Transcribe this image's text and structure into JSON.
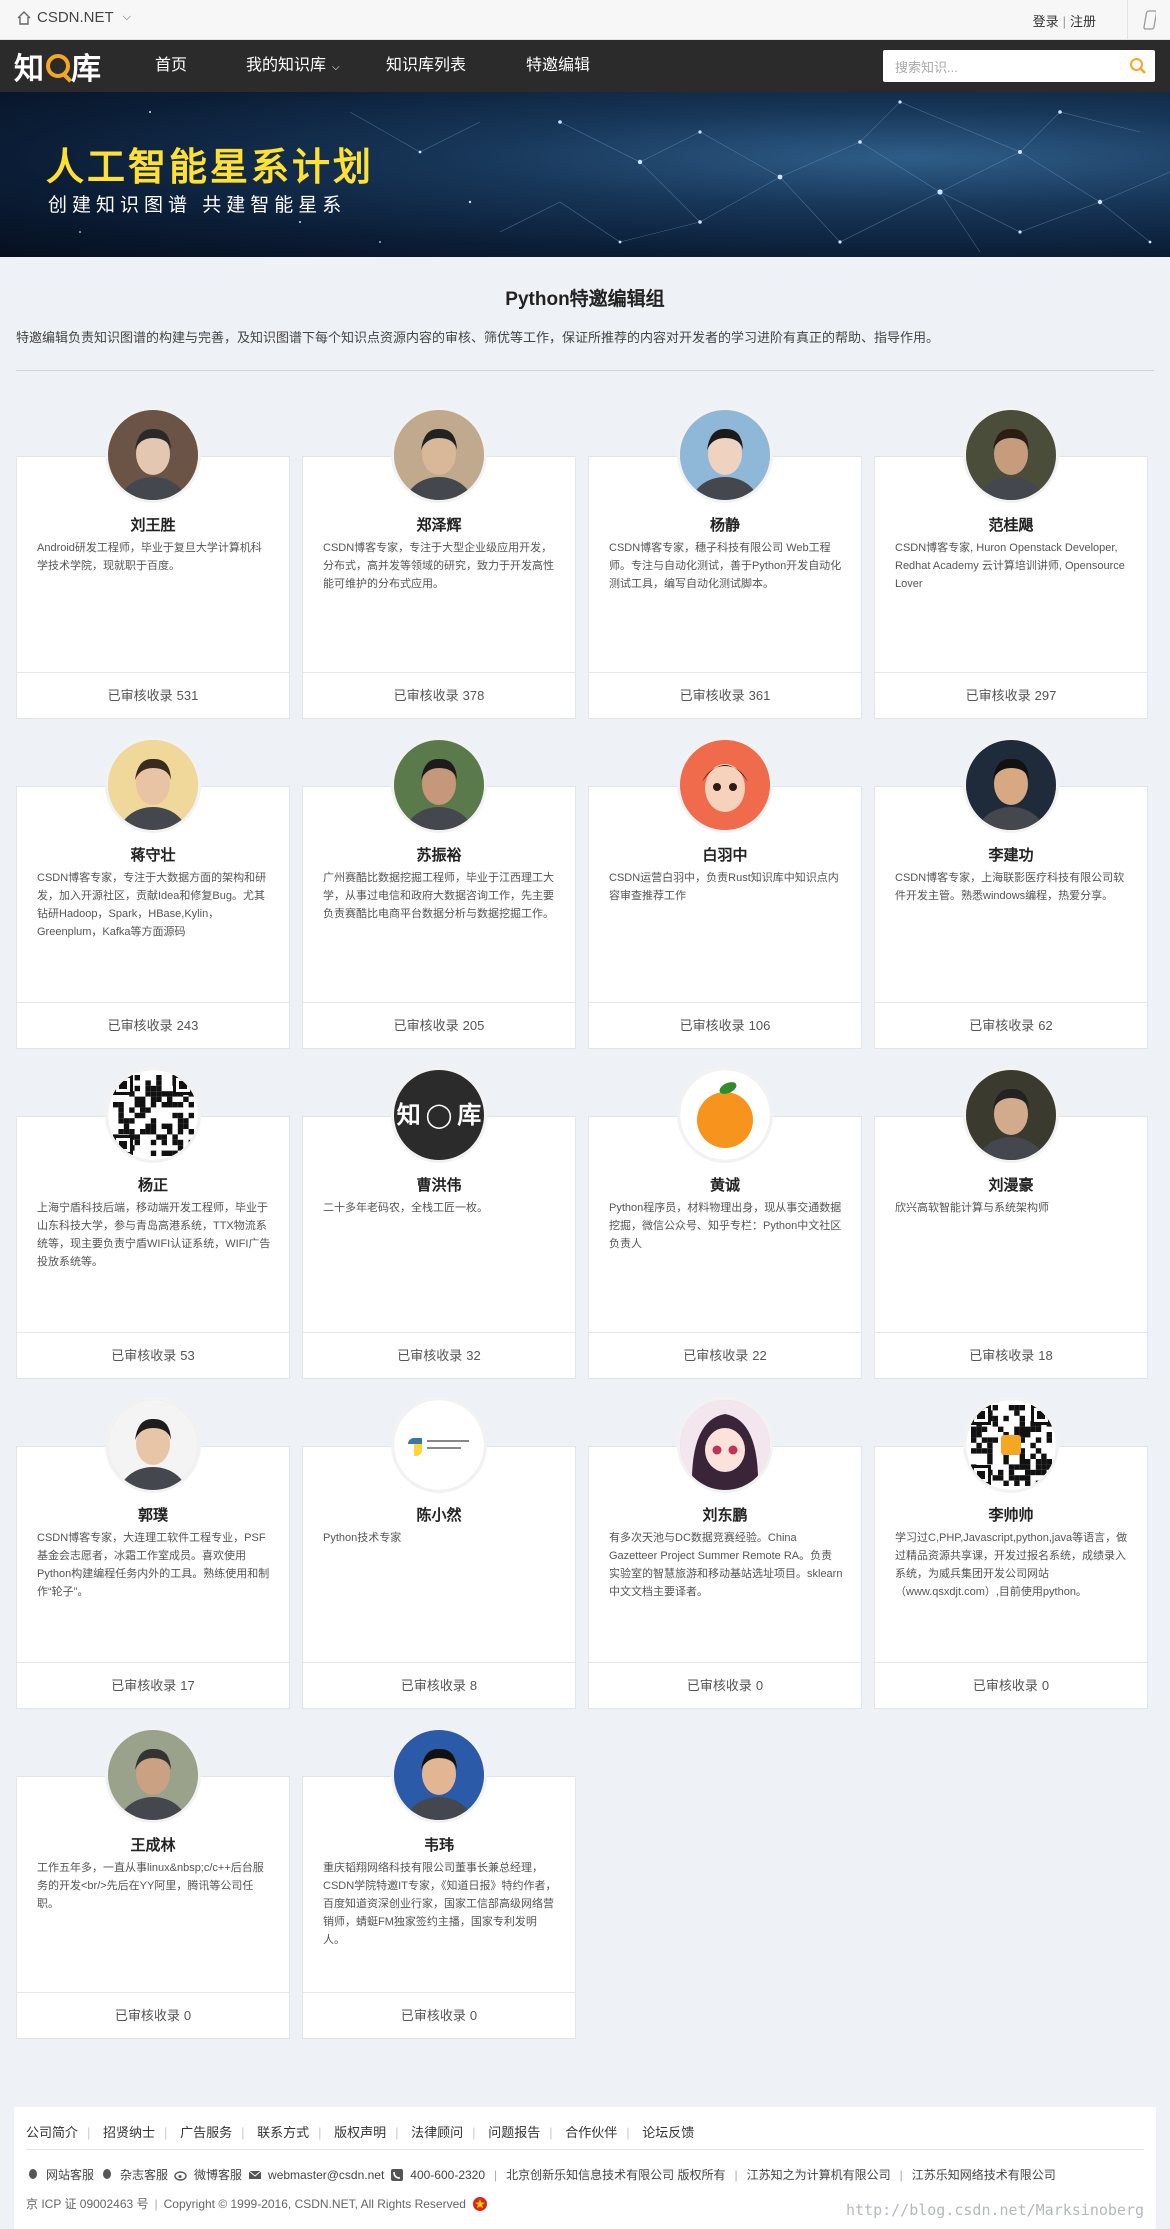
{
  "topbar": {
    "brand": "CSDN.NET",
    "login": "登录",
    "register": "注册"
  },
  "nav": {
    "logo": {
      "chars": [
        "知",
        "库"
      ]
    },
    "items": [
      {
        "label": "首页"
      },
      {
        "label": "我的知识库"
      },
      {
        "label": "知识库列表"
      },
      {
        "label": "特邀编辑"
      }
    ],
    "search_placeholder": "搜索知识..."
  },
  "banner": {
    "title": "人工智能星系计划",
    "subtitle": "创建知识图谱  共建智能星系"
  },
  "section": {
    "title": "Python特邀编辑组",
    "description": "特邀编辑负责知识图谱的构建与完善，及知识图谱下每个知识点资源内容的审核、筛优等工作，保证所推荐的内容对开发者的学习进阶有真正的帮助、指导作用。"
  },
  "count_prefix": "已审核收录",
  "editors": [
    {
      "name": "刘王胜",
      "desc": "Android研发工程师，毕业于复旦大学计算机科学技术学院，现就职于百度。",
      "count": 531,
      "avatar": "photo"
    },
    {
      "name": "郑泽辉",
      "desc": "CSDN博客专家，专注于大型企业级应用开发，分布式，高并发等领域的研究，致力于开发高性能可维护的分布式应用。",
      "count": 378,
      "avatar": "photo"
    },
    {
      "name": "杨静",
      "desc": "CSDN博客专家，穗子科技有限公司 Web工程师。专注与自动化测试，善于Python开发自动化测试工具，编写自动化测试脚本。",
      "count": 361,
      "avatar": "photo"
    },
    {
      "name": "范桂飓",
      "desc": "CSDN博客专家, Huron Openstack Developer, Redhat Academy 云计算培训讲师, Opensource Lover",
      "count": 297,
      "avatar": "photo"
    },
    {
      "name": "蒋守壮",
      "desc": "CSDN博客专家，专注于大数据方面的架构和研发，加入开源社区，贡献Idea和修复Bug。尤其钻研Hadoop，Spark，HBase,Kylin，Greenplum，Kafka等方面源码",
      "count": 243,
      "avatar": "photo"
    },
    {
      "name": "苏振裕",
      "desc": "广州赛酷比数据挖掘工程师，毕业于江西理工大学，从事过电信和政府大数据咨询工作，先主要负责赛酷比电商平台数据分析与数据挖掘工作。",
      "count": 205,
      "avatar": "photo"
    },
    {
      "name": "白羽中",
      "desc": "CSDN运营白羽中，负责Rust知识库中知识点内容审查推荐工作",
      "count": 106,
      "avatar": "cartoon"
    },
    {
      "name": "李建功",
      "desc": "CSDN博客专家，上海联影医疗科技有限公司软件开发主管。熟悉windows编程，热爱分享。",
      "count": 62,
      "avatar": "photo"
    },
    {
      "name": "杨正",
      "desc": "上海宁盾科技后端，移动端开发工程师，毕业于山东科技大学，参与青岛高港系统，TTX物流系统等，现主要负责宁盾WIFI认证系统，WIFI广告投放系统等。",
      "count": 53,
      "avatar": "qr"
    },
    {
      "name": "曹洪伟",
      "desc": "二十多年老码农，全栈工匠一枚。",
      "count": 32,
      "avatar": "logo"
    },
    {
      "name": "黄诚",
      "desc": "Python程序员，材料物理出身，现从事交通数据挖掘，微信公众号、知乎专栏：Python中文社区 负责人",
      "count": 22,
      "avatar": "orange"
    },
    {
      "name": "刘漫豪",
      "desc": "欣兴高软智能计算与系统架构师",
      "count": 18,
      "avatar": "photo"
    },
    {
      "name": "郭璞",
      "desc": "CSDN博客专家，大连理工软件工程专业，PSF基金会志愿者，冰霜工作室成员。喜欢使用Python构建编程任务内外的工具。熟练使用和制作“轮子”。",
      "count": 17,
      "avatar": "photo"
    },
    {
      "name": "陈小然",
      "desc": "Python技术专家",
      "count": 8,
      "avatar": "python"
    },
    {
      "name": "刘东鹏",
      "desc": "有多次天池与DC数据竞赛经验。China Gazetteer Project Summer Remote RA。负责实验室的智慧旅游和移动基站选址项目。sklearn中文文档主要译者。",
      "count": 0,
      "avatar": "anime"
    },
    {
      "name": "李帅帅",
      "desc": "学习过C,PHP,Javascript,python,java等语言，做过精品资源共享课，开发过报名系统，成绩录入系统，为威兵集团开发公司网站（www.qsxdjt.com）,目前使用python。",
      "count": 0,
      "avatar": "qr2"
    },
    {
      "name": "王成林",
      "desc": "工作五年多，一直从事linux&nbsp;c/c++后台服务的开发<br/>先后在YY阿里，腾讯等公司任职。",
      "count": 0,
      "avatar": "photo"
    },
    {
      "name": "韦玮",
      "desc": "重庆韬翔网络科技有限公司董事长兼总经理，CSDN学院特邀IT专家，《知道日报》特约作者，百度知道资深创业行家，国家工信部高级网络营销师，蜻蜓FM独家签约主播，国家专利发明人。",
      "count": 0,
      "avatar": "photo"
    }
  ],
  "footer": {
    "links": [
      "公司简介",
      "招贤纳士",
      "广告服务",
      "联系方式",
      "版权声明",
      "法律顾问",
      "问题报告",
      "合作伙伴",
      "论坛反馈"
    ],
    "contacts": [
      "网站客服",
      "杂志客服",
      "微博客服"
    ],
    "email": "webmaster@csdn.net",
    "phone": "400-600-2320",
    "companies": [
      "北京创新乐知信息技术有限公司 版权所有",
      "江苏知之为计算机有限公司",
      "江苏乐知网络技术有限公司"
    ],
    "icp": "京 ICP 证 09002463 号",
    "copyright": "Copyright © 1999-2016, CSDN.NET, All Rights Reserved"
  },
  "watermark": "http://blog.csdn.net/Marksinoberg",
  "colors": {
    "accent": "#f5a623",
    "banner_title": "#ffe033",
    "nav_bg": "#2b2b2b",
    "page_bg": "#eef1f6"
  }
}
